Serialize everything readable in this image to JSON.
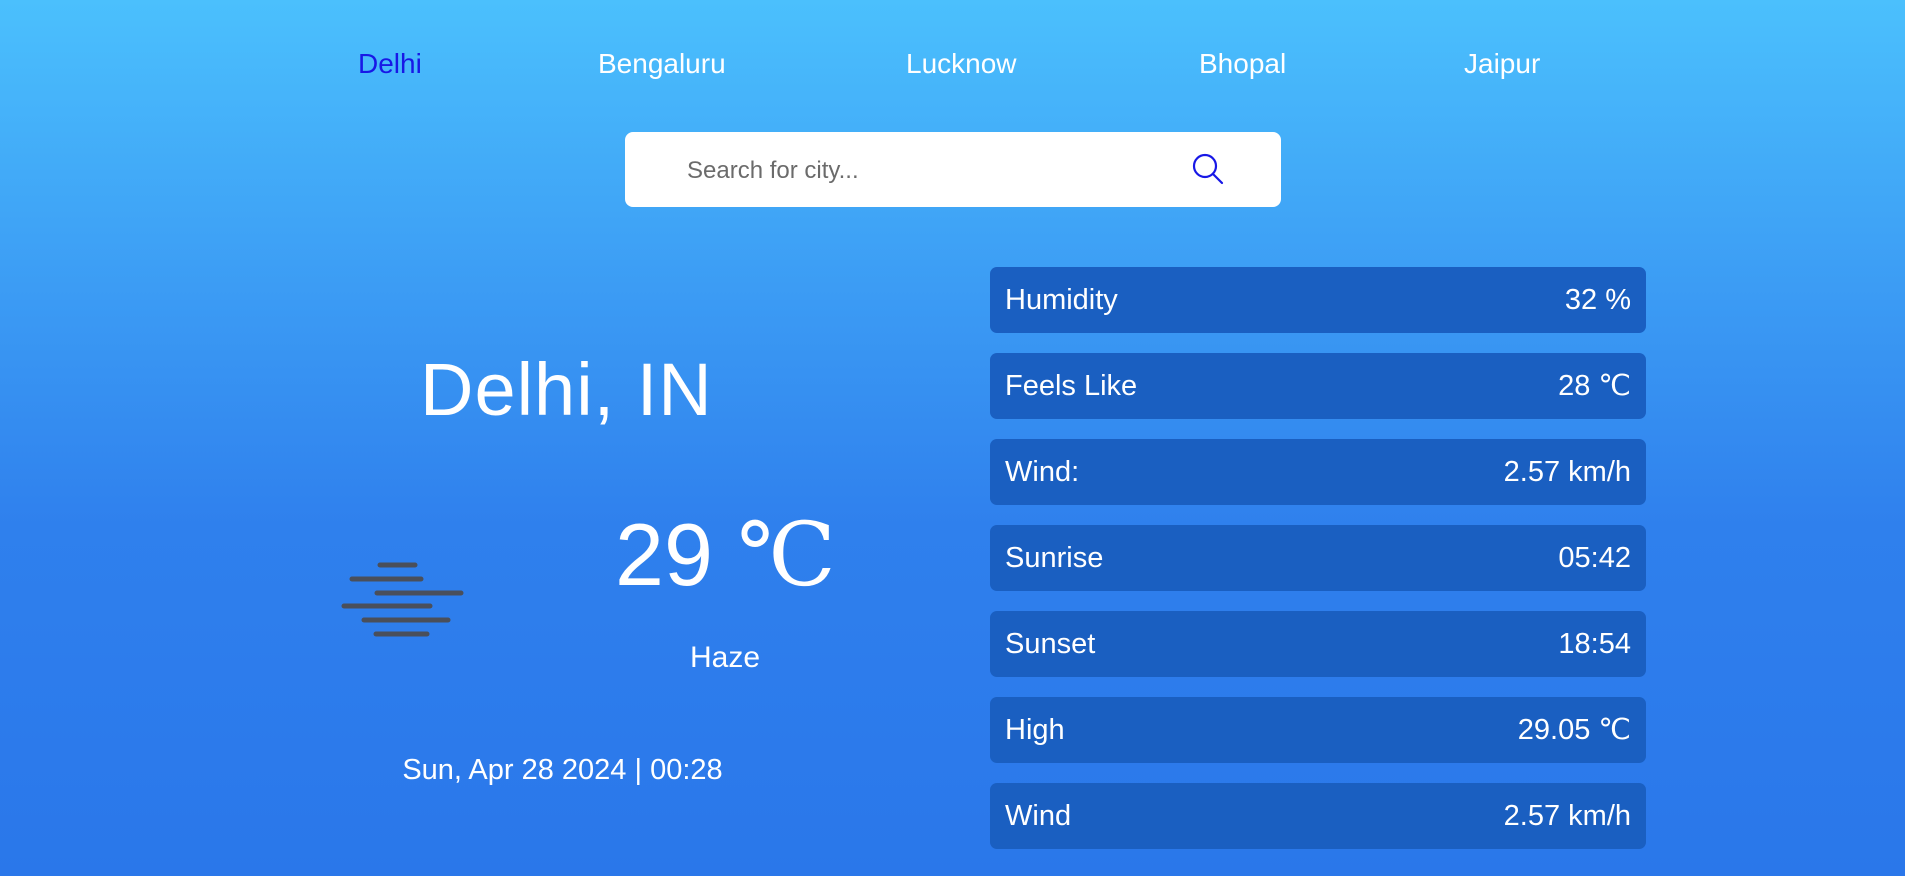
{
  "nav": {
    "items": [
      {
        "label": "Delhi",
        "active": true
      },
      {
        "label": "Bengaluru",
        "active": false
      },
      {
        "label": "Lucknow",
        "active": false
      },
      {
        "label": "Bhopal",
        "active": false
      },
      {
        "label": "Jaipur",
        "active": false
      }
    ]
  },
  "search": {
    "placeholder": "Search for city...",
    "value": "",
    "icon": "search-icon"
  },
  "current": {
    "city": "Delhi, IN",
    "temperature": "29",
    "temperature_unit": "℃",
    "condition": "Haze",
    "condition_icon": "haze-icon",
    "datetime": "Sun, Apr 28 2024 | 00:28"
  },
  "stats": [
    {
      "label": "Humidity",
      "value": "32 %"
    },
    {
      "label": "Feels Like",
      "value": "28 ℃"
    },
    {
      "label": "Wind:",
      "value": "2.57 km/h"
    },
    {
      "label": "Sunrise",
      "value": "05:42"
    },
    {
      "label": "Sunset",
      "value": "18:54"
    },
    {
      "label": "High",
      "value": "29.05 ℃"
    },
    {
      "label": "Wind",
      "value": "2.57 km/h"
    }
  ],
  "colors": {
    "active_nav": "#1818e6",
    "stat_card": "#1a5fc1",
    "search_icon": "#1818e6"
  }
}
